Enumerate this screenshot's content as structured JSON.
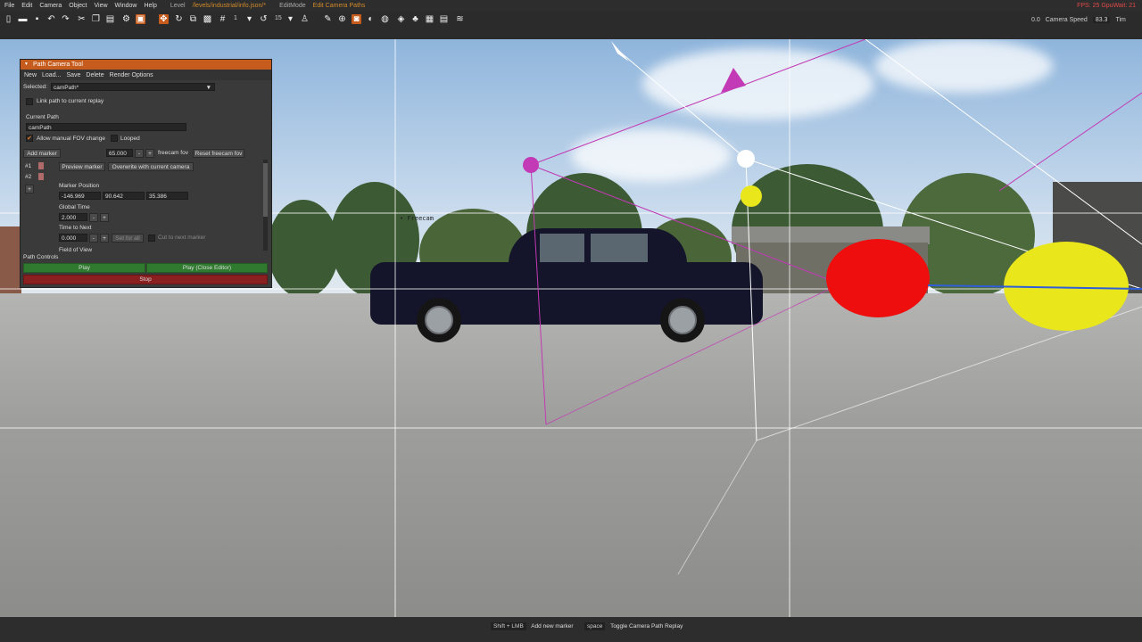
{
  "menubar": {
    "items": [
      "File",
      "Edit",
      "Camera",
      "Object",
      "View",
      "Window",
      "Help"
    ],
    "level_label": "Level",
    "level_path": "/levels/industrial/info.json/*",
    "edit_mode_label": "EditMode",
    "edit_mode_value": "Edit Camera Paths",
    "fps": "FPS: 25  GpuWait: 21"
  },
  "toolbar": {
    "snap_value": "1",
    "rotate_value": "15",
    "camera_speed_label": "Camera Speed",
    "camera_speed_value": "83.3",
    "speed_prefix": "0.0",
    "tim_label": "Tim"
  },
  "viewport": {
    "freecam_label": "• Freecam"
  },
  "panel": {
    "title": "Path Camera Tool",
    "menu": [
      "New",
      "Load...",
      "Save",
      "Delete",
      "Render Options"
    ],
    "selected_label": "Selected:",
    "selected_value": "camPath*",
    "link_path_label": "Link path to current replay",
    "current_path_label": "Current Path",
    "current_path_value": "camPath",
    "allow_fov_label": "Allow manual FOV change",
    "looped_label": "Looped",
    "add_marker": "Add marker",
    "fov_value": "65.000",
    "minus": "-",
    "plus": "+",
    "freecam_fov": "freecam fov",
    "reset_freecam_fov": "Reset freecam fov",
    "markers": [
      "#1",
      "#2"
    ],
    "add_small": "+",
    "preview_marker": "Preview marker",
    "overwrite_camera": "Overwrite with current camera",
    "marker_position_label": "Marker Position",
    "pos_x": "-146.969",
    "pos_y": "90.642",
    "pos_z": "35.386",
    "global_time_label": "Global Time",
    "global_time_value": "2.000",
    "time_to_next_label": "Time to Next",
    "time_to_next_value": "0.000",
    "set_for_all": "Set for all",
    "cut_to_next": "Cut to next marker",
    "field_of_view_label": "Field of View",
    "path_controls_label": "Path Controls",
    "play": "Play",
    "play_close": "Play (Close Editor)",
    "stop": "Stop"
  },
  "statusbar": {
    "hint1_key": "Shift + LMB",
    "hint1_text": "Add new marker",
    "hint2_key": "space",
    "hint2_text": "Toggle Camera Path Replay"
  },
  "colors": {
    "accent": "#c55c1d",
    "play_green": "#2f7a2f",
    "stop_red": "#8a1f1f",
    "marker_magenta": "#c23ab5",
    "sphere_red": "#ee0e0e",
    "sphere_yellow": "#e9e71c"
  }
}
